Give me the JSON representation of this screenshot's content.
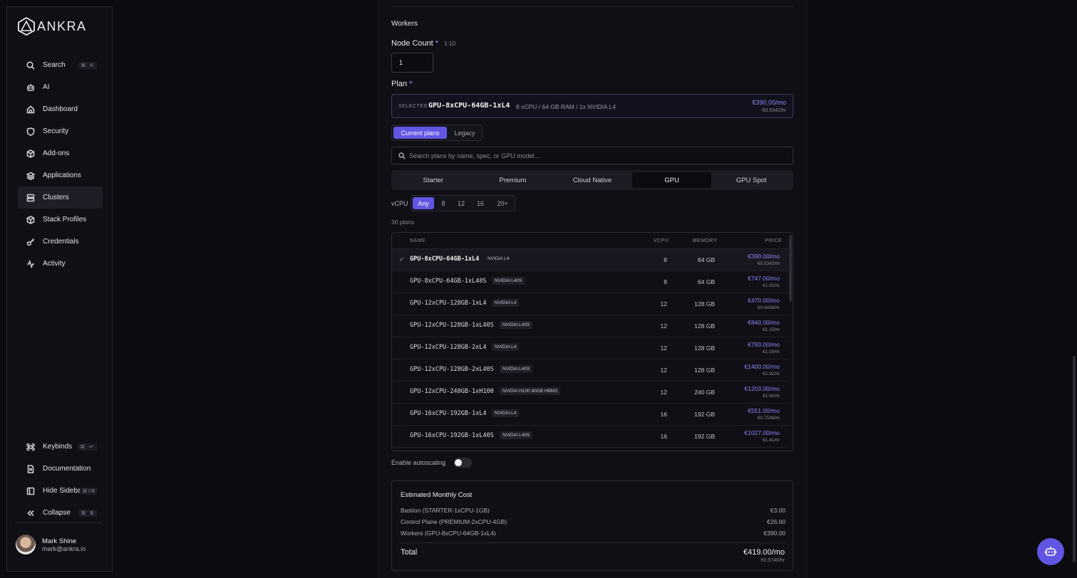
{
  "brand": {
    "name": "ANKRA"
  },
  "sidebar": {
    "items": [
      {
        "label": "Search",
        "icon": "search-icon",
        "shortcut": "⌘ K"
      },
      {
        "label": "AI",
        "icon": "robot-icon"
      },
      {
        "label": "Dashboard",
        "icon": "home-icon"
      },
      {
        "label": "Security",
        "icon": "shield-icon"
      },
      {
        "label": "Add-ons",
        "icon": "package-icon"
      },
      {
        "label": "Applications",
        "icon": "layers-icon"
      },
      {
        "label": "Clusters",
        "icon": "server-icon",
        "active": true
      },
      {
        "label": "Stack Profiles",
        "icon": "box-icon"
      },
      {
        "label": "Credentials",
        "icon": "key-icon"
      },
      {
        "label": "Activity",
        "icon": "activity-icon"
      }
    ],
    "bottom": [
      {
        "label": "Keybinds",
        "icon": "command-icon",
        "shortcut": "⌘ ↵"
      },
      {
        "label": "Documentation",
        "icon": "document-icon"
      },
      {
        "label": "Hide Sidebar",
        "icon": "sidebar-icon",
        "shortcut": "⌘⇧B"
      },
      {
        "label": "Collapse",
        "icon": "chevrons-left-icon",
        "shortcut": "⌘ B"
      }
    ],
    "user": {
      "name": "Mark Shine",
      "email": "mark@ankra.io"
    }
  },
  "workers": {
    "section_title": "Workers",
    "node_count": {
      "label": "Node Count",
      "required": "*",
      "hint": "1-10",
      "value": "1"
    },
    "plan": {
      "label": "Plan",
      "required": "*",
      "selected_tag": "SELECTED",
      "selected_name": "GPU-8xCPU-64GB-1xL4",
      "selected_spec": "8 vCPU / 64 GB RAM / 1x NVIDIA L4",
      "selected_price": "€390.00/mo",
      "selected_hourly": "€0.5342/hr"
    },
    "plan_toggle": {
      "current": "Current plans",
      "legacy": "Legacy"
    },
    "search_placeholder": "Search plans by name, spec, or GPU model...",
    "categories": [
      "Starter",
      "Premium",
      "Cloud Native",
      "GPU",
      "GPU Spot"
    ],
    "active_category": "GPU",
    "vcpu_filter": {
      "label": "vCPU",
      "options": [
        "Any",
        "8",
        "12",
        "16",
        "20+"
      ],
      "selected": "Any"
    },
    "plans_count": "30 plans",
    "table": {
      "headers": {
        "name": "NAME",
        "vcpu": "VCPU",
        "memory": "MEMORY",
        "price": "PRICE"
      },
      "rows": [
        {
          "name": "GPU-8xCPU-64GB-1xL4",
          "gpu": "NVIDIA L4",
          "vcpu": "8",
          "memory": "64 GB",
          "price": "€390.00/mo",
          "hourly": "€0.5342/hr",
          "selected": true
        },
        {
          "name": "GPU-8xCPU-64GB-1xL40S",
          "gpu": "NVIDIA L40S",
          "vcpu": "8",
          "memory": "64 GB",
          "price": "€747.00/mo",
          "hourly": "€1.02/hr"
        },
        {
          "name": "GPU-12xCPU-128GB-1xL4",
          "gpu": "NVIDIA L4",
          "vcpu": "12",
          "memory": "128 GB",
          "price": "€470.00/mo",
          "hourly": "€0.6438/hr"
        },
        {
          "name": "GPU-12xCPU-128GB-1xL40S",
          "gpu": "NVIDIA L40S",
          "vcpu": "12",
          "memory": "128 GB",
          "price": "€840.00/mo",
          "hourly": "€1.15/hr"
        },
        {
          "name": "GPU-12xCPU-128GB-2xL4",
          "gpu": "NVIDIA L4",
          "vcpu": "12",
          "memory": "128 GB",
          "price": "€793.00/mo",
          "hourly": "€1.09/hr"
        },
        {
          "name": "GPU-12xCPU-128GB-2xL40S",
          "gpu": "NVIDIA L40S",
          "vcpu": "12",
          "memory": "128 GB",
          "price": "€1400.00/mo",
          "hourly": "€1.92/hr"
        },
        {
          "name": "GPU-12xCPU-240GB-1xH100",
          "gpu": "NVIDIA H100 80GB HBM3",
          "vcpu": "12",
          "memory": "240 GB",
          "price": "€1203.00/mo",
          "hourly": "€1.65/hr"
        },
        {
          "name": "GPU-16xCPU-192GB-1xL4",
          "gpu": "NVIDIA L4",
          "vcpu": "16",
          "memory": "192 GB",
          "price": "€551.00/mo",
          "hourly": "€0.7548/hr"
        },
        {
          "name": "GPU-16xCPU-192GB-1xL40S",
          "gpu": "NVIDIA L40S",
          "vcpu": "16",
          "memory": "192 GB",
          "price": "€1027.00/mo",
          "hourly": "€1.41/hr"
        }
      ]
    },
    "autoscaling": {
      "label": "Enable autoscaling",
      "enabled": false
    }
  },
  "cost": {
    "title": "Estimated Monthly Cost",
    "lines": [
      {
        "label": "Bastion (STARTER-1xCPU-1GB)",
        "value": "€3.00"
      },
      {
        "label": "Control Plane (PREMIUM-2xCPU-4GB)",
        "value": "€26.00"
      },
      {
        "label": "Workers (GPU-8xCPU-64GB-1xL4)",
        "value": "€390.00"
      }
    ],
    "total_label": "Total",
    "total_value": "€419.00/mo",
    "total_hourly": "€0.5740/hr"
  },
  "colors": {
    "accent": "#6156e3",
    "price": "#8f86f7",
    "background": "#0b0b10"
  }
}
